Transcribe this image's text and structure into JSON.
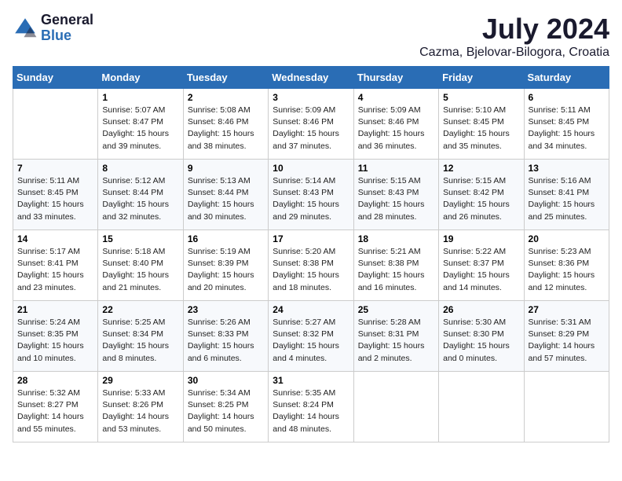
{
  "header": {
    "logo_general": "General",
    "logo_blue": "Blue",
    "month_title": "July 2024",
    "location": "Cazma, Bjelovar-Bilogora, Croatia"
  },
  "days_of_week": [
    "Sunday",
    "Monday",
    "Tuesday",
    "Wednesday",
    "Thursday",
    "Friday",
    "Saturday"
  ],
  "weeks": [
    [
      {
        "day": "",
        "sunrise": "",
        "sunset": "",
        "daylight": ""
      },
      {
        "day": "1",
        "sunrise": "Sunrise: 5:07 AM",
        "sunset": "Sunset: 8:47 PM",
        "daylight": "Daylight: 15 hours and 39 minutes."
      },
      {
        "day": "2",
        "sunrise": "Sunrise: 5:08 AM",
        "sunset": "Sunset: 8:46 PM",
        "daylight": "Daylight: 15 hours and 38 minutes."
      },
      {
        "day": "3",
        "sunrise": "Sunrise: 5:09 AM",
        "sunset": "Sunset: 8:46 PM",
        "daylight": "Daylight: 15 hours and 37 minutes."
      },
      {
        "day": "4",
        "sunrise": "Sunrise: 5:09 AM",
        "sunset": "Sunset: 8:46 PM",
        "daylight": "Daylight: 15 hours and 36 minutes."
      },
      {
        "day": "5",
        "sunrise": "Sunrise: 5:10 AM",
        "sunset": "Sunset: 8:45 PM",
        "daylight": "Daylight: 15 hours and 35 minutes."
      },
      {
        "day": "6",
        "sunrise": "Sunrise: 5:11 AM",
        "sunset": "Sunset: 8:45 PM",
        "daylight": "Daylight: 15 hours and 34 minutes."
      }
    ],
    [
      {
        "day": "7",
        "sunrise": "Sunrise: 5:11 AM",
        "sunset": "Sunset: 8:45 PM",
        "daylight": "Daylight: 15 hours and 33 minutes."
      },
      {
        "day": "8",
        "sunrise": "Sunrise: 5:12 AM",
        "sunset": "Sunset: 8:44 PM",
        "daylight": "Daylight: 15 hours and 32 minutes."
      },
      {
        "day": "9",
        "sunrise": "Sunrise: 5:13 AM",
        "sunset": "Sunset: 8:44 PM",
        "daylight": "Daylight: 15 hours and 30 minutes."
      },
      {
        "day": "10",
        "sunrise": "Sunrise: 5:14 AM",
        "sunset": "Sunset: 8:43 PM",
        "daylight": "Daylight: 15 hours and 29 minutes."
      },
      {
        "day": "11",
        "sunrise": "Sunrise: 5:15 AM",
        "sunset": "Sunset: 8:43 PM",
        "daylight": "Daylight: 15 hours and 28 minutes."
      },
      {
        "day": "12",
        "sunrise": "Sunrise: 5:15 AM",
        "sunset": "Sunset: 8:42 PM",
        "daylight": "Daylight: 15 hours and 26 minutes."
      },
      {
        "day": "13",
        "sunrise": "Sunrise: 5:16 AM",
        "sunset": "Sunset: 8:41 PM",
        "daylight": "Daylight: 15 hours and 25 minutes."
      }
    ],
    [
      {
        "day": "14",
        "sunrise": "Sunrise: 5:17 AM",
        "sunset": "Sunset: 8:41 PM",
        "daylight": "Daylight: 15 hours and 23 minutes."
      },
      {
        "day": "15",
        "sunrise": "Sunrise: 5:18 AM",
        "sunset": "Sunset: 8:40 PM",
        "daylight": "Daylight: 15 hours and 21 minutes."
      },
      {
        "day": "16",
        "sunrise": "Sunrise: 5:19 AM",
        "sunset": "Sunset: 8:39 PM",
        "daylight": "Daylight: 15 hours and 20 minutes."
      },
      {
        "day": "17",
        "sunrise": "Sunrise: 5:20 AM",
        "sunset": "Sunset: 8:38 PM",
        "daylight": "Daylight: 15 hours and 18 minutes."
      },
      {
        "day": "18",
        "sunrise": "Sunrise: 5:21 AM",
        "sunset": "Sunset: 8:38 PM",
        "daylight": "Daylight: 15 hours and 16 minutes."
      },
      {
        "day": "19",
        "sunrise": "Sunrise: 5:22 AM",
        "sunset": "Sunset: 8:37 PM",
        "daylight": "Daylight: 15 hours and 14 minutes."
      },
      {
        "day": "20",
        "sunrise": "Sunrise: 5:23 AM",
        "sunset": "Sunset: 8:36 PM",
        "daylight": "Daylight: 15 hours and 12 minutes."
      }
    ],
    [
      {
        "day": "21",
        "sunrise": "Sunrise: 5:24 AM",
        "sunset": "Sunset: 8:35 PM",
        "daylight": "Daylight: 15 hours and 10 minutes."
      },
      {
        "day": "22",
        "sunrise": "Sunrise: 5:25 AM",
        "sunset": "Sunset: 8:34 PM",
        "daylight": "Daylight: 15 hours and 8 minutes."
      },
      {
        "day": "23",
        "sunrise": "Sunrise: 5:26 AM",
        "sunset": "Sunset: 8:33 PM",
        "daylight": "Daylight: 15 hours and 6 minutes."
      },
      {
        "day": "24",
        "sunrise": "Sunrise: 5:27 AM",
        "sunset": "Sunset: 8:32 PM",
        "daylight": "Daylight: 15 hours and 4 minutes."
      },
      {
        "day": "25",
        "sunrise": "Sunrise: 5:28 AM",
        "sunset": "Sunset: 8:31 PM",
        "daylight": "Daylight: 15 hours and 2 minutes."
      },
      {
        "day": "26",
        "sunrise": "Sunrise: 5:30 AM",
        "sunset": "Sunset: 8:30 PM",
        "daylight": "Daylight: 15 hours and 0 minutes."
      },
      {
        "day": "27",
        "sunrise": "Sunrise: 5:31 AM",
        "sunset": "Sunset: 8:29 PM",
        "daylight": "Daylight: 14 hours and 57 minutes."
      }
    ],
    [
      {
        "day": "28",
        "sunrise": "Sunrise: 5:32 AM",
        "sunset": "Sunset: 8:27 PM",
        "daylight": "Daylight: 14 hours and 55 minutes."
      },
      {
        "day": "29",
        "sunrise": "Sunrise: 5:33 AM",
        "sunset": "Sunset: 8:26 PM",
        "daylight": "Daylight: 14 hours and 53 minutes."
      },
      {
        "day": "30",
        "sunrise": "Sunrise: 5:34 AM",
        "sunset": "Sunset: 8:25 PM",
        "daylight": "Daylight: 14 hours and 50 minutes."
      },
      {
        "day": "31",
        "sunrise": "Sunrise: 5:35 AM",
        "sunset": "Sunset: 8:24 PM",
        "daylight": "Daylight: 14 hours and 48 minutes."
      },
      {
        "day": "",
        "sunrise": "",
        "sunset": "",
        "daylight": ""
      },
      {
        "day": "",
        "sunrise": "",
        "sunset": "",
        "daylight": ""
      },
      {
        "day": "",
        "sunrise": "",
        "sunset": "",
        "daylight": ""
      }
    ]
  ]
}
